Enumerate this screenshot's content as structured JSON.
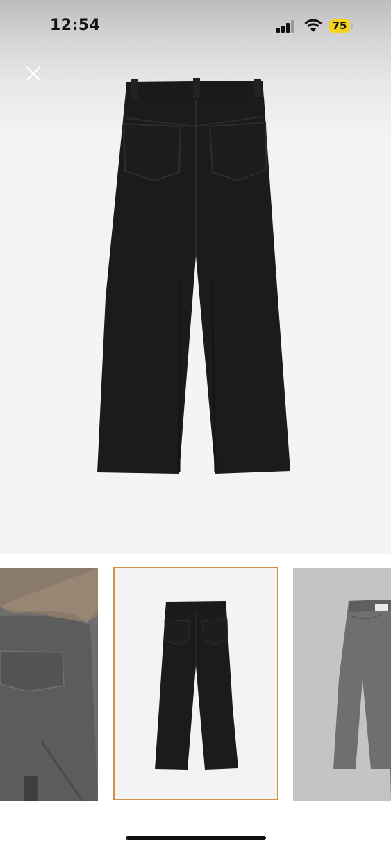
{
  "status_bar": {
    "time": "12:54",
    "battery_level": "75",
    "signal_icon": "cellular-signal-icon",
    "wifi_icon": "wifi-icon",
    "battery_color": "#f6d21a"
  },
  "viewer": {
    "close_icon": "close-icon",
    "main_image": "black-jeans-back-view",
    "selected_thumbnail": 2
  },
  "thumbnails": [
    {
      "image": "model-wearing-jeans-back-view",
      "selected": false
    },
    {
      "image": "black-jeans-back-view",
      "selected": true
    },
    {
      "image": "grey-jeans-front-view",
      "selected": false
    }
  ],
  "colors": {
    "selected_border": "#d28e48",
    "garment": "#1b1b1b"
  }
}
